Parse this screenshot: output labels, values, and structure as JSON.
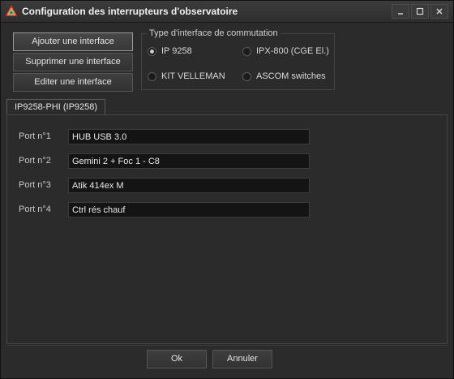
{
  "window": {
    "title": "Configuration des interrupteurs d'observatoire"
  },
  "actions": {
    "add": "Ajouter une interface",
    "remove": "Supprimer une interface",
    "edit": "Editer une interface"
  },
  "interface_type": {
    "legend": "Type d'interface de commutation",
    "options": [
      {
        "label": "IP 9258",
        "checked": true
      },
      {
        "label": "IPX-800 (CGE El.)",
        "checked": false
      },
      {
        "label": "KIT VELLEMAN",
        "checked": false
      },
      {
        "label": "ASCOM switches",
        "checked": false
      }
    ]
  },
  "tabs": [
    {
      "label": "IP9258-PHI (IP9258)"
    }
  ],
  "ports": [
    {
      "label": "Port n°1",
      "value": "HUB USB 3.0"
    },
    {
      "label": "Port n°2",
      "value": "Gemini 2 + Foc 1 - C8"
    },
    {
      "label": "Port n°3",
      "value": "Atik 414ex M"
    },
    {
      "label": "Port n°4",
      "value": "Ctrl rés chauf"
    }
  ],
  "footer": {
    "ok": "Ok",
    "cancel": "Annuler"
  },
  "icons": {
    "app": "rainbow-triangle-icon",
    "minimize": "minimize-icon",
    "maximize": "maximize-icon",
    "close": "close-icon"
  }
}
